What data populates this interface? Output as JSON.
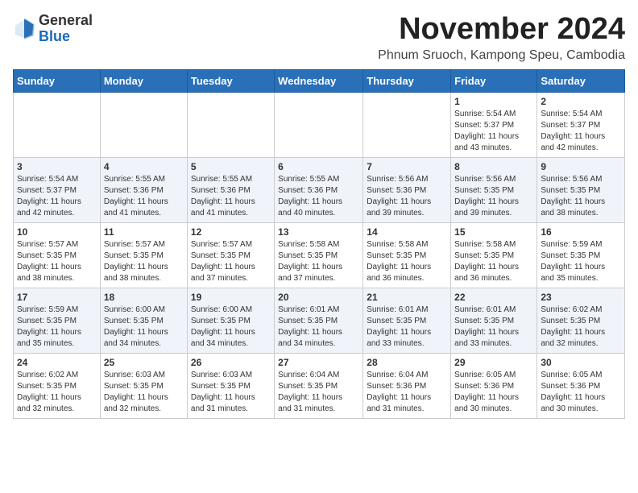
{
  "header": {
    "logo_general": "General",
    "logo_blue": "Blue",
    "month_title": "November 2024",
    "location": "Phnum Sruoch, Kampong Speu, Cambodia"
  },
  "days_of_week": [
    "Sunday",
    "Monday",
    "Tuesday",
    "Wednesday",
    "Thursday",
    "Friday",
    "Saturday"
  ],
  "weeks": [
    [
      {
        "day": "",
        "info": ""
      },
      {
        "day": "",
        "info": ""
      },
      {
        "day": "",
        "info": ""
      },
      {
        "day": "",
        "info": ""
      },
      {
        "day": "",
        "info": ""
      },
      {
        "day": "1",
        "info": "Sunrise: 5:54 AM\nSunset: 5:37 PM\nDaylight: 11 hours\nand 43 minutes."
      },
      {
        "day": "2",
        "info": "Sunrise: 5:54 AM\nSunset: 5:37 PM\nDaylight: 11 hours\nand 42 minutes."
      }
    ],
    [
      {
        "day": "3",
        "info": "Sunrise: 5:54 AM\nSunset: 5:37 PM\nDaylight: 11 hours\nand 42 minutes."
      },
      {
        "day": "4",
        "info": "Sunrise: 5:55 AM\nSunset: 5:36 PM\nDaylight: 11 hours\nand 41 minutes."
      },
      {
        "day": "5",
        "info": "Sunrise: 5:55 AM\nSunset: 5:36 PM\nDaylight: 11 hours\nand 41 minutes."
      },
      {
        "day": "6",
        "info": "Sunrise: 5:55 AM\nSunset: 5:36 PM\nDaylight: 11 hours\nand 40 minutes."
      },
      {
        "day": "7",
        "info": "Sunrise: 5:56 AM\nSunset: 5:36 PM\nDaylight: 11 hours\nand 39 minutes."
      },
      {
        "day": "8",
        "info": "Sunrise: 5:56 AM\nSunset: 5:35 PM\nDaylight: 11 hours\nand 39 minutes."
      },
      {
        "day": "9",
        "info": "Sunrise: 5:56 AM\nSunset: 5:35 PM\nDaylight: 11 hours\nand 38 minutes."
      }
    ],
    [
      {
        "day": "10",
        "info": "Sunrise: 5:57 AM\nSunset: 5:35 PM\nDaylight: 11 hours\nand 38 minutes."
      },
      {
        "day": "11",
        "info": "Sunrise: 5:57 AM\nSunset: 5:35 PM\nDaylight: 11 hours\nand 38 minutes."
      },
      {
        "day": "12",
        "info": "Sunrise: 5:57 AM\nSunset: 5:35 PM\nDaylight: 11 hours\nand 37 minutes."
      },
      {
        "day": "13",
        "info": "Sunrise: 5:58 AM\nSunset: 5:35 PM\nDaylight: 11 hours\nand 37 minutes."
      },
      {
        "day": "14",
        "info": "Sunrise: 5:58 AM\nSunset: 5:35 PM\nDaylight: 11 hours\nand 36 minutes."
      },
      {
        "day": "15",
        "info": "Sunrise: 5:58 AM\nSunset: 5:35 PM\nDaylight: 11 hours\nand 36 minutes."
      },
      {
        "day": "16",
        "info": "Sunrise: 5:59 AM\nSunset: 5:35 PM\nDaylight: 11 hours\nand 35 minutes."
      }
    ],
    [
      {
        "day": "17",
        "info": "Sunrise: 5:59 AM\nSunset: 5:35 PM\nDaylight: 11 hours\nand 35 minutes."
      },
      {
        "day": "18",
        "info": "Sunrise: 6:00 AM\nSunset: 5:35 PM\nDaylight: 11 hours\nand 34 minutes."
      },
      {
        "day": "19",
        "info": "Sunrise: 6:00 AM\nSunset: 5:35 PM\nDaylight: 11 hours\nand 34 minutes."
      },
      {
        "day": "20",
        "info": "Sunrise: 6:01 AM\nSunset: 5:35 PM\nDaylight: 11 hours\nand 34 minutes."
      },
      {
        "day": "21",
        "info": "Sunrise: 6:01 AM\nSunset: 5:35 PM\nDaylight: 11 hours\nand 33 minutes."
      },
      {
        "day": "22",
        "info": "Sunrise: 6:01 AM\nSunset: 5:35 PM\nDaylight: 11 hours\nand 33 minutes."
      },
      {
        "day": "23",
        "info": "Sunrise: 6:02 AM\nSunset: 5:35 PM\nDaylight: 11 hours\nand 32 minutes."
      }
    ],
    [
      {
        "day": "24",
        "info": "Sunrise: 6:02 AM\nSunset: 5:35 PM\nDaylight: 11 hours\nand 32 minutes."
      },
      {
        "day": "25",
        "info": "Sunrise: 6:03 AM\nSunset: 5:35 PM\nDaylight: 11 hours\nand 32 minutes."
      },
      {
        "day": "26",
        "info": "Sunrise: 6:03 AM\nSunset: 5:35 PM\nDaylight: 11 hours\nand 31 minutes."
      },
      {
        "day": "27",
        "info": "Sunrise: 6:04 AM\nSunset: 5:35 PM\nDaylight: 11 hours\nand 31 minutes."
      },
      {
        "day": "28",
        "info": "Sunrise: 6:04 AM\nSunset: 5:36 PM\nDaylight: 11 hours\nand 31 minutes."
      },
      {
        "day": "29",
        "info": "Sunrise: 6:05 AM\nSunset: 5:36 PM\nDaylight: 11 hours\nand 30 minutes."
      },
      {
        "day": "30",
        "info": "Sunrise: 6:05 AM\nSunset: 5:36 PM\nDaylight: 11 hours\nand 30 minutes."
      }
    ]
  ]
}
